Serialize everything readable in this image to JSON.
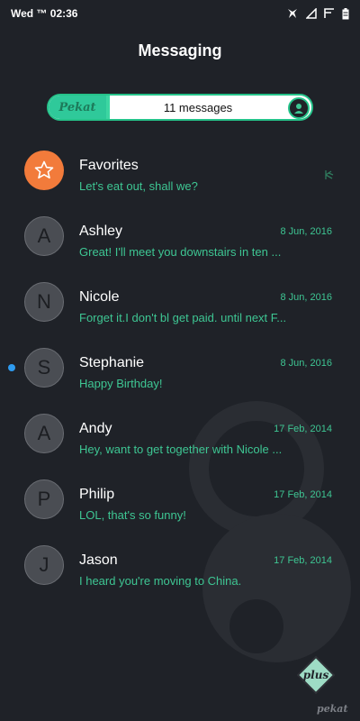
{
  "status_bar": {
    "time": "Wed ™ 02:36",
    "icons": [
      "notification-icon",
      "signal-icon",
      "wifi-icon",
      "battery-icon"
    ]
  },
  "header": {
    "title": "Messaging"
  },
  "banner": {
    "logo_text": "Pekat",
    "message_count": "11 messages"
  },
  "conversations": [
    {
      "initial": "",
      "name": "Favorites",
      "preview": "Let's eat out, shall we?",
      "date": "",
      "favorite": true,
      "unread": false
    },
    {
      "initial": "A",
      "name": "Ashley",
      "preview": "Great! I'll meet you downstairs in ten ...",
      "date": "8 Jun, 2016",
      "favorite": false,
      "unread": false
    },
    {
      "initial": "N",
      "name": "Nicole",
      "preview": "Forget it.I don't bl get paid. until next F...",
      "date": "8 Jun, 2016",
      "favorite": false,
      "unread": false
    },
    {
      "initial": "S",
      "name": "Stephanie",
      "preview": "Happy Birthday!",
      "date": "8 Jun, 2016",
      "favorite": false,
      "unread": true
    },
    {
      "initial": "A",
      "name": "Andy",
      "preview": "Hey, want to get together with Nicole ...",
      "date": "17 Feb, 2014",
      "favorite": false,
      "unread": false
    },
    {
      "initial": "P",
      "name": "Philip",
      "preview": "LOL, that's so funny!",
      "date": "17 Feb, 2014",
      "favorite": false,
      "unread": false
    },
    {
      "initial": "J",
      "name": "Jason",
      "preview": "I heard you're moving to China.",
      "date": "17 Feb, 2014",
      "favorite": false,
      "unread": false
    }
  ],
  "watermark": {
    "badge_text": "plus",
    "brand_text": "pekat"
  },
  "colors": {
    "background": "#1f2228",
    "accent_green": "#3ec693",
    "favorite_orange": "#f27b3b",
    "unread_blue": "#2e9bf0",
    "avatar_grey": "#4a4d53"
  }
}
